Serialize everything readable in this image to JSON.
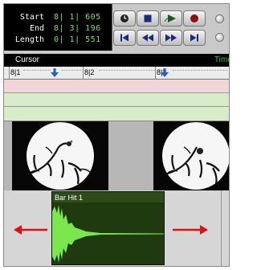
{
  "counters": {
    "start_label": "Start",
    "start_value": "8| 1| 605",
    "end_label": "End",
    "end_value": "8| 3| 196",
    "length_label": "Length",
    "length_value": "0| 1| 551"
  },
  "transport": {
    "buttons": [
      "clock-icon",
      "stop-icon",
      "play-icon",
      "record-icon",
      "return-to-start-icon",
      "rewind-icon",
      "fast-forward-icon",
      "go-to-end-icon"
    ]
  },
  "header": {
    "cursor_label": "Cursor",
    "timeline_label": "Timel"
  },
  "ruler": {
    "labels": [
      "8|1",
      "8|2",
      "8|3"
    ]
  },
  "audio_region": {
    "name": "Bar Hit 1"
  },
  "colors": {
    "counter_text": "#7be05a",
    "timeline_label": "#2ecc40",
    "region_fill": "#1f3a0e",
    "waveform": "#66dd33",
    "arrow": "#e01010"
  }
}
